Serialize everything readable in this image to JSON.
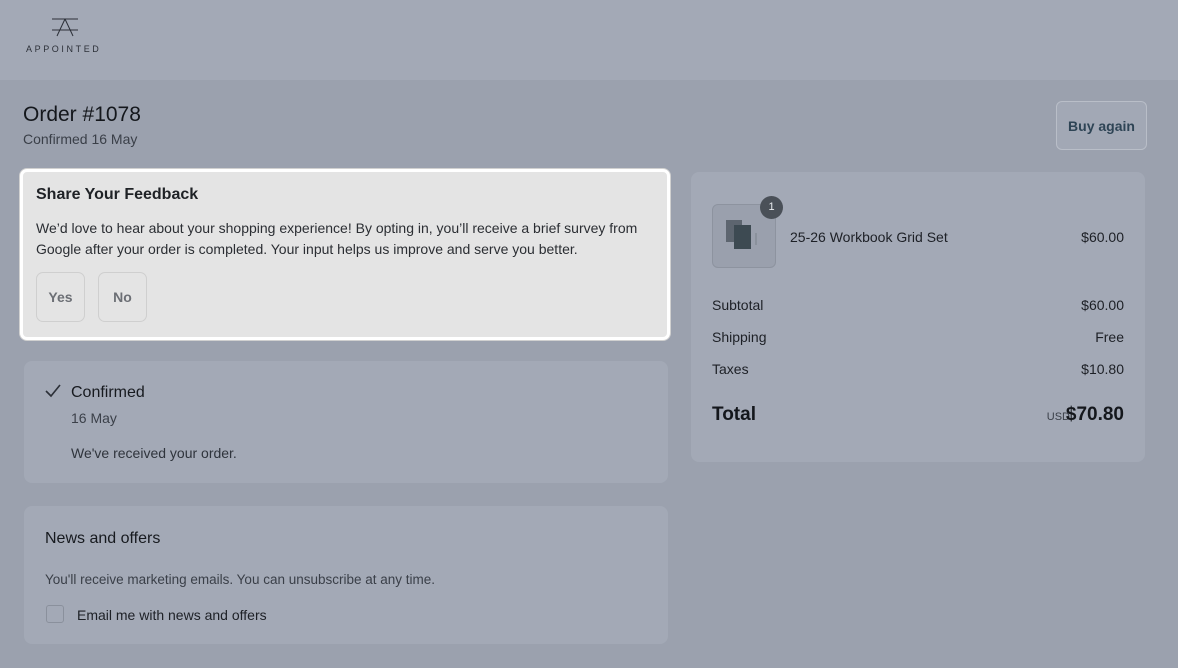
{
  "brand": {
    "logo_text": "APPOINTED"
  },
  "order": {
    "title": "Order #1078",
    "subtitle": "Confirmed 16 May",
    "buy_again_label": "Buy again"
  },
  "feedback": {
    "title": "Share Your Feedback",
    "body": "We’d love to hear about your shopping experience! By opting in, you’ll receive a brief survey from Google after your order is completed. Your input helps us improve and serve you better.",
    "yes_label": "Yes",
    "no_label": "No"
  },
  "status": {
    "title": "Confirmed",
    "date": "16 May",
    "message": "We've received your order.",
    "icon": "check-icon"
  },
  "news": {
    "title": "News and offers",
    "description": "You'll receive marketing emails. You can unsubscribe at any time.",
    "checkbox_label": "Email me with news and offers",
    "checked": false
  },
  "summary": {
    "product": {
      "name": "25-26 Workbook Grid Set",
      "price": "$60.00",
      "quantity": "1"
    },
    "rows": [
      {
        "label": "Subtotal",
        "value": "$60.00"
      },
      {
        "label": "Shipping",
        "value": "Free"
      },
      {
        "label": "Taxes",
        "value": "$10.80"
      }
    ],
    "total_label": "Total",
    "currency": "USD",
    "total_value": "$70.80"
  },
  "colors": {
    "page_bg": "#9ba1ae",
    "card_bg": "#a3a9b6",
    "feedback_bg": "#e4e4e4",
    "accent": "#2e4455"
  }
}
